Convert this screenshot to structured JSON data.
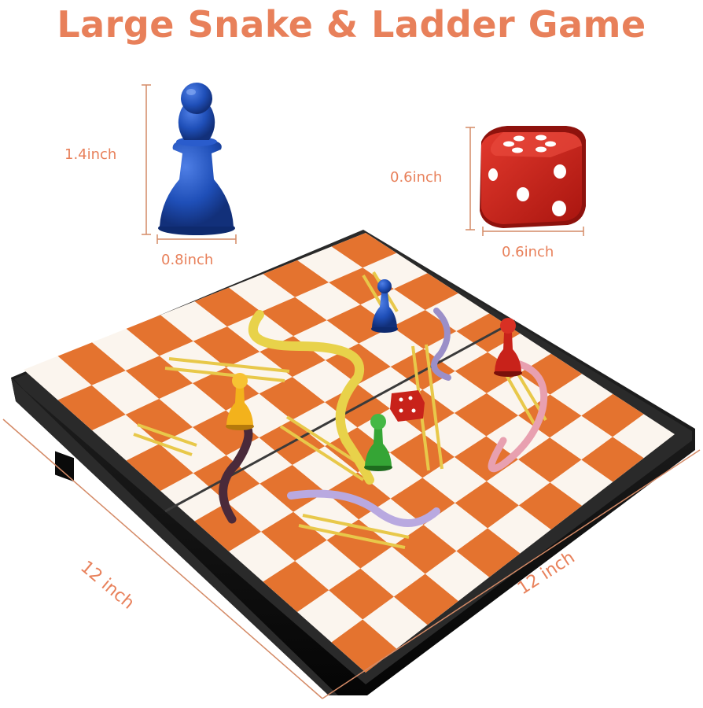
{
  "title": "Large Snake & Ladder Game",
  "dimensions": {
    "pawn_height": "1.4inch",
    "pawn_width": "0.8inch",
    "dice_height": "0.6inch",
    "dice_width": "0.6inch",
    "board_left": "12 inch",
    "board_right": "12 inch"
  },
  "colors": {
    "accent": "#e8805a",
    "line": "#d48a66",
    "board_orange": "#e4732f",
    "board_white": "#fbf5ee",
    "frame": "#151515",
    "pawn_blue": "#1f4fb8",
    "pawn_red": "#c8221a",
    "pawn_yellow": "#f3b21c",
    "pawn_green": "#35a535",
    "dice_red": "#d52a21"
  }
}
